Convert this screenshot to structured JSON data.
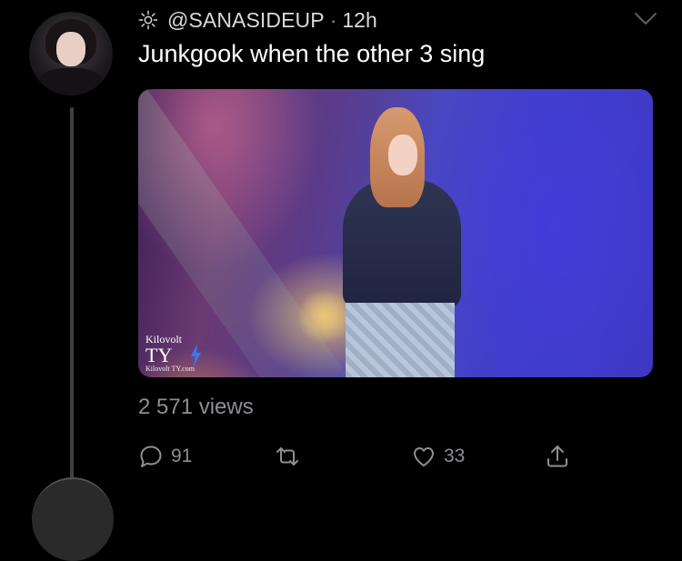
{
  "tweet": {
    "handle": "@SANASIDEUP",
    "separator": "·",
    "time": "12h",
    "text": "Junkgook when the other 3 sing",
    "views": "2 571 views"
  },
  "media": {
    "watermark_brand": "Kilovolt",
    "watermark_logo": "TY",
    "watermark_url": "Kilovolt TY.com"
  },
  "actions": {
    "reply_count": "91",
    "retweet_count": "",
    "like_count": "33"
  },
  "icons": {
    "status": "sun-icon",
    "menu": "chevron-down-icon",
    "reply": "reply-icon",
    "retweet": "retweet-icon",
    "like": "heart-icon",
    "share": "share-icon"
  },
  "colors": {
    "background": "#000000",
    "text": "#ffffff",
    "secondary": "#8e8e93",
    "thread_line": "#3e4144"
  }
}
